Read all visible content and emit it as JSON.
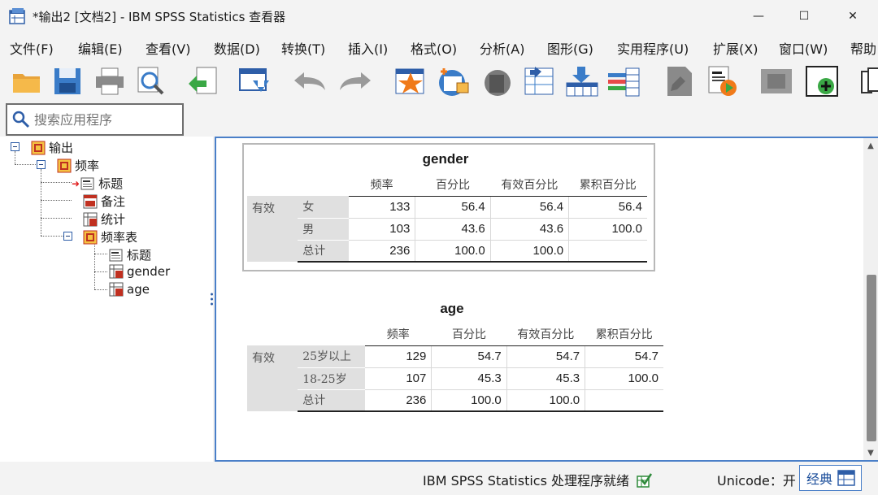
{
  "window": {
    "title": "*输出2 [文档2] - IBM SPSS Statistics 查看器",
    "minimize": "—",
    "maximize": "☐",
    "close": "✕"
  },
  "menu": [
    {
      "label": "文件(F)"
    },
    {
      "label": "编辑(E)"
    },
    {
      "label": "查看(V)"
    },
    {
      "label": "数据(D)"
    },
    {
      "label": "转换(T)"
    },
    {
      "label": "插入(I)"
    },
    {
      "label": "格式(O)"
    },
    {
      "label": "分析(A)"
    },
    {
      "label": "图形(G)"
    },
    {
      "label": "实用程序(U)"
    },
    {
      "label": "扩展(X)"
    },
    {
      "label": "窗口(W)"
    },
    {
      "label": "帮助"
    }
  ],
  "toolbar_icons": [
    "open-folder-icon",
    "save-icon",
    "print-icon",
    "print-preview-icon",
    "export-icon",
    "recall-dialog-icon",
    "undo-icon",
    "redo-icon",
    "goto-data-icon",
    "goto-case-icon",
    "goto-variable-icon",
    "variables-icon",
    "insert-cases-icon",
    "split-file-icon",
    "select-cases-icon",
    "designate-window-icon",
    "show-all-icon",
    "hide-icon",
    "promote-icon"
  ],
  "search": {
    "placeholder": "搜索应用程序"
  },
  "tree": {
    "root": "输出",
    "frequencies": "频率",
    "title1": "标题",
    "notes": "备注",
    "statistics": "统计",
    "freq_table": "频率表",
    "title2": "标题",
    "gender": "gender",
    "age": "age"
  },
  "tables": {
    "gender": {
      "title": "gender",
      "headers": [
        "频率",
        "百分比",
        "有效百分比",
        "累积百分比"
      ],
      "group_label": "有效",
      "rows": [
        {
          "label": "女",
          "values": [
            "133",
            "56.4",
            "56.4",
            "56.4"
          ]
        },
        {
          "label": "男",
          "values": [
            "103",
            "43.6",
            "43.6",
            "100.0"
          ]
        },
        {
          "label": "总计",
          "values": [
            "236",
            "100.0",
            "100.0",
            ""
          ]
        }
      ]
    },
    "age": {
      "title": "age",
      "headers": [
        "频率",
        "百分比",
        "有效百分比",
        "累积百分比"
      ],
      "group_label": "有效",
      "rows": [
        {
          "label": "25岁以上",
          "values": [
            "129",
            "54.7",
            "54.7",
            "54.7"
          ]
        },
        {
          "label": "18-25岁",
          "values": [
            "107",
            "45.3",
            "45.3",
            "100.0"
          ]
        },
        {
          "label": "总计",
          "values": [
            "236",
            "100.0",
            "100.0",
            ""
          ]
        }
      ]
    }
  },
  "status": {
    "processor": "IBM SPSS Statistics 处理程序就绪",
    "unicode": "Unicode：开",
    "classic": "经典"
  }
}
